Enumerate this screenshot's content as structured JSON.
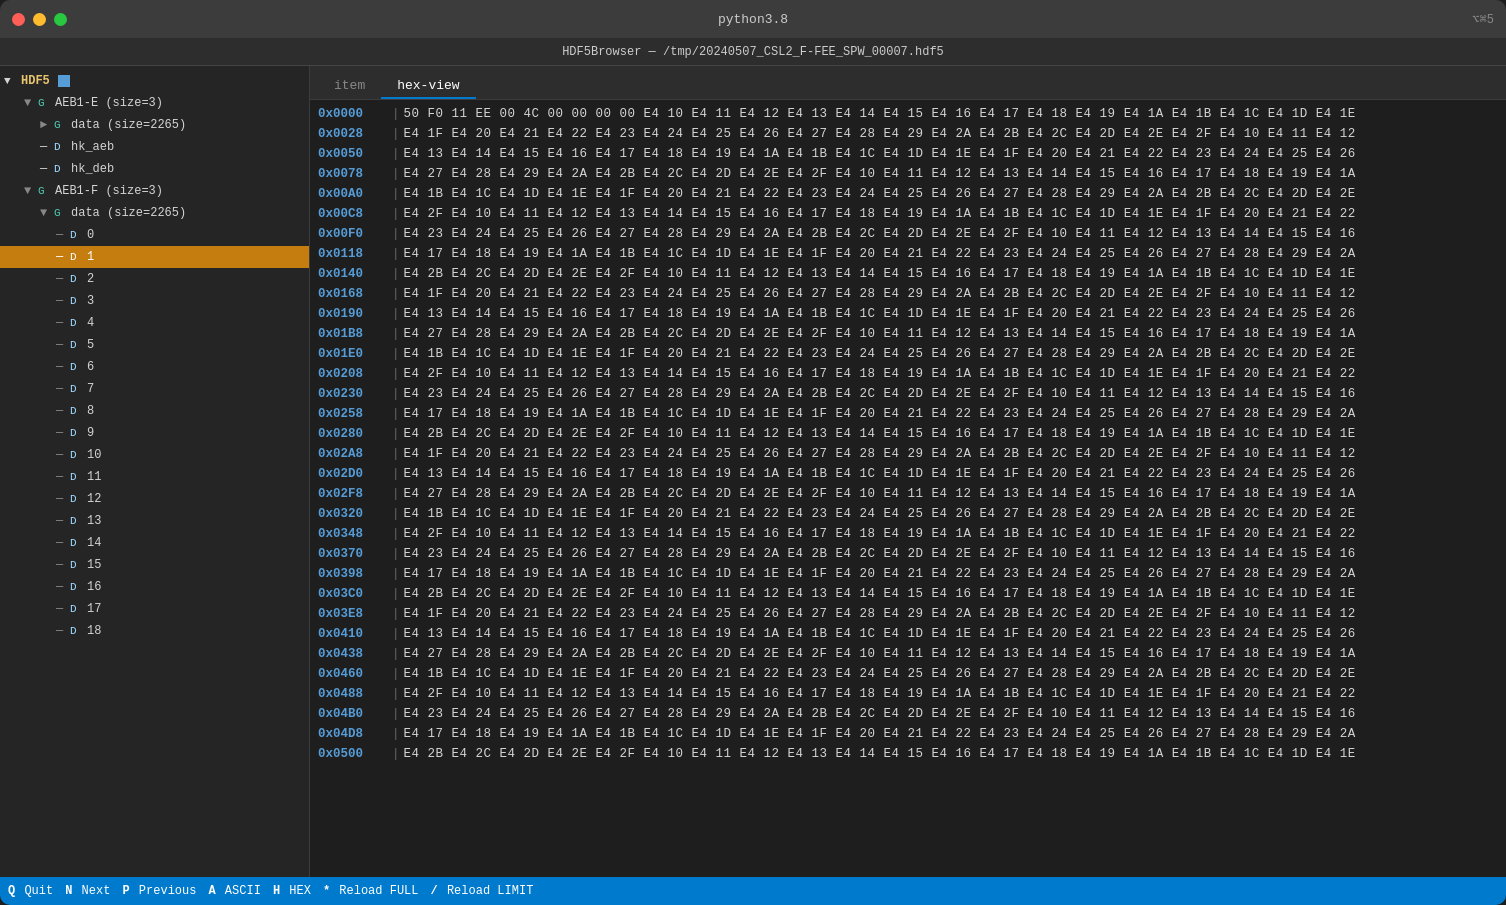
{
  "window": {
    "title": "python3.8",
    "subtitle": "HDF5Browser — /tmp/20240507_CSL2_F-FEE_SPW_00007.hdf5",
    "shortcut": "⌥⌘5"
  },
  "sidebar": {
    "root_label": "HDF5",
    "items": [
      {
        "id": "aeb1e",
        "indent": 1,
        "type": "G",
        "label": "AEB1-E (size=3)",
        "arrow": "▼",
        "expanded": true
      },
      {
        "id": "data_aeb1e",
        "indent": 2,
        "type": "G",
        "label": "data (size=2265)",
        "arrow": "►",
        "expanded": false
      },
      {
        "id": "hk_aeb",
        "indent": 2,
        "type": "D",
        "label": "hk_aeb",
        "arrow": "",
        "expanded": false
      },
      {
        "id": "hk_deb",
        "indent": 2,
        "type": "D",
        "label": "hk_deb",
        "arrow": "",
        "expanded": false
      },
      {
        "id": "aeb1f",
        "indent": 1,
        "type": "G",
        "label": "AEB1-F (size=3)",
        "arrow": "▼",
        "expanded": true
      },
      {
        "id": "data_aeb1f",
        "indent": 2,
        "type": "G",
        "label": "data (size=2265)",
        "arrow": "▼",
        "expanded": true
      },
      {
        "id": "d0",
        "indent": 3,
        "type": "D",
        "label": "0",
        "arrow": "",
        "expanded": false
      },
      {
        "id": "d1",
        "indent": 3,
        "type": "D",
        "label": "1",
        "arrow": "",
        "expanded": false,
        "selected": true
      },
      {
        "id": "d2",
        "indent": 3,
        "type": "D",
        "label": "2",
        "arrow": "",
        "expanded": false
      },
      {
        "id": "d3",
        "indent": 3,
        "type": "D",
        "label": "3",
        "arrow": "",
        "expanded": false
      },
      {
        "id": "d4",
        "indent": 3,
        "type": "D",
        "label": "4",
        "arrow": "",
        "expanded": false
      },
      {
        "id": "d5",
        "indent": 3,
        "type": "D",
        "label": "5",
        "arrow": "",
        "expanded": false
      },
      {
        "id": "d6",
        "indent": 3,
        "type": "D",
        "label": "6",
        "arrow": "",
        "expanded": false
      },
      {
        "id": "d7",
        "indent": 3,
        "type": "D",
        "label": "7",
        "arrow": "",
        "expanded": false
      },
      {
        "id": "d8",
        "indent": 3,
        "type": "D",
        "label": "8",
        "arrow": "",
        "expanded": false
      },
      {
        "id": "d9",
        "indent": 3,
        "type": "D",
        "label": "9",
        "arrow": "",
        "expanded": false
      },
      {
        "id": "d10",
        "indent": 3,
        "type": "D",
        "label": "10",
        "arrow": "",
        "expanded": false
      },
      {
        "id": "d11",
        "indent": 3,
        "type": "D",
        "label": "11",
        "arrow": "",
        "expanded": false
      },
      {
        "id": "d12",
        "indent": 3,
        "type": "D",
        "label": "12",
        "arrow": "",
        "expanded": false
      },
      {
        "id": "d13",
        "indent": 3,
        "type": "D",
        "label": "13",
        "arrow": "",
        "expanded": false
      },
      {
        "id": "d14",
        "indent": 3,
        "type": "D",
        "label": "14",
        "arrow": "",
        "expanded": false
      },
      {
        "id": "d15",
        "indent": 3,
        "type": "D",
        "label": "15",
        "arrow": "",
        "expanded": false
      },
      {
        "id": "d16",
        "indent": 3,
        "type": "D",
        "label": "16",
        "arrow": "",
        "expanded": false
      },
      {
        "id": "d17",
        "indent": 3,
        "type": "D",
        "label": "17",
        "arrow": "",
        "expanded": false
      },
      {
        "id": "d18",
        "indent": 3,
        "type": "D",
        "label": "18",
        "arrow": "",
        "expanded": false
      }
    ]
  },
  "tabs": [
    {
      "id": "item",
      "label": "item"
    },
    {
      "id": "hex-view",
      "label": "hex-view",
      "active": true
    }
  ],
  "hex_rows": [
    {
      "addr": "0x0000",
      "bytes": "50 F0 11 EE 00 4C 00 00 00 00 E4 10 E4 11 E4 12 E4 13 E4 14 E4 15 E4 16 E4 17 E4 18 E4 19 E4 1A E4 1B E4 1C E4 1D E4 1E"
    },
    {
      "addr": "0x0028",
      "bytes": "E4 1F E4 20 E4 21 E4 22 E4 23 E4 24 E4 25 E4 26 E4 27 E4 28 E4 29 E4 2A E4 2B E4 2C E4 2D E4 2E E4 2F E4 10 E4 11 E4 12"
    },
    {
      "addr": "0x0050",
      "bytes": "E4 13 E4 14 E4 15 E4 16 E4 17 E4 18 E4 19 E4 1A E4 1B E4 1C E4 1D E4 1E E4 1F E4 20 E4 21 E4 22 E4 23 E4 24 E4 25 E4 26"
    },
    {
      "addr": "0x0078",
      "bytes": "E4 27 E4 28 E4 29 E4 2A E4 2B E4 2C E4 2D E4 2E E4 2F E4 10 E4 11 E4 12 E4 13 E4 14 E4 15 E4 16 E4 17 E4 18 E4 19 E4 1A"
    },
    {
      "addr": "0x00A0",
      "bytes": "E4 1B E4 1C E4 1D E4 1E E4 1F E4 20 E4 21 E4 22 E4 23 E4 24 E4 25 E4 26 E4 27 E4 28 E4 29 E4 2A E4 2B E4 2C E4 2D E4 2E"
    },
    {
      "addr": "0x00C8",
      "bytes": "E4 2F E4 10 E4 11 E4 12 E4 13 E4 14 E4 15 E4 16 E4 17 E4 18 E4 19 E4 1A E4 1B E4 1C E4 1D E4 1E E4 1F E4 20 E4 21 E4 22"
    },
    {
      "addr": "0x00F0",
      "bytes": "E4 23 E4 24 E4 25 E4 26 E4 27 E4 28 E4 29 E4 2A E4 2B E4 2C E4 2D E4 2E E4 2F E4 10 E4 11 E4 12 E4 13 E4 14 E4 15 E4 16"
    },
    {
      "addr": "0x0118",
      "bytes": "E4 17 E4 18 E4 19 E4 1A E4 1B E4 1C E4 1D E4 1E E4 1F E4 20 E4 21 E4 22 E4 23 E4 24 E4 25 E4 26 E4 27 E4 28 E4 29 E4 2A"
    },
    {
      "addr": "0x0140",
      "bytes": "E4 2B E4 2C E4 2D E4 2E E4 2F E4 10 E4 11 E4 12 E4 13 E4 14 E4 15 E4 16 E4 17 E4 18 E4 19 E4 1A E4 1B E4 1C E4 1D E4 1E"
    },
    {
      "addr": "0x0168",
      "bytes": "E4 1F E4 20 E4 21 E4 22 E4 23 E4 24 E4 25 E4 26 E4 27 E4 28 E4 29 E4 2A E4 2B E4 2C E4 2D E4 2E E4 2F E4 10 E4 11 E4 12"
    },
    {
      "addr": "0x0190",
      "bytes": "E4 13 E4 14 E4 15 E4 16 E4 17 E4 18 E4 19 E4 1A E4 1B E4 1C E4 1D E4 1E E4 1F E4 20 E4 21 E4 22 E4 23 E4 24 E4 25 E4 26"
    },
    {
      "addr": "0x01B8",
      "bytes": "E4 27 E4 28 E4 29 E4 2A E4 2B E4 2C E4 2D E4 2E E4 2F E4 10 E4 11 E4 12 E4 13 E4 14 E4 15 E4 16 E4 17 E4 18 E4 19 E4 1A"
    },
    {
      "addr": "0x01E0",
      "bytes": "E4 1B E4 1C E4 1D E4 1E E4 1F E4 20 E4 21 E4 22 E4 23 E4 24 E4 25 E4 26 E4 27 E4 28 E4 29 E4 2A E4 2B E4 2C E4 2D E4 2E"
    },
    {
      "addr": "0x0208",
      "bytes": "E4 2F E4 10 E4 11 E4 12 E4 13 E4 14 E4 15 E4 16 E4 17 E4 18 E4 19 E4 1A E4 1B E4 1C E4 1D E4 1E E4 1F E4 20 E4 21 E4 22"
    },
    {
      "addr": "0x0230",
      "bytes": "E4 23 E4 24 E4 25 E4 26 E4 27 E4 28 E4 29 E4 2A E4 2B E4 2C E4 2D E4 2E E4 2F E4 10 E4 11 E4 12 E4 13 E4 14 E4 15 E4 16"
    },
    {
      "addr": "0x0258",
      "bytes": "E4 17 E4 18 E4 19 E4 1A E4 1B E4 1C E4 1D E4 1E E4 1F E4 20 E4 21 E4 22 E4 23 E4 24 E4 25 E4 26 E4 27 E4 28 E4 29 E4 2A"
    },
    {
      "addr": "0x0280",
      "bytes": "E4 2B E4 2C E4 2D E4 2E E4 2F E4 10 E4 11 E4 12 E4 13 E4 14 E4 15 E4 16 E4 17 E4 18 E4 19 E4 1A E4 1B E4 1C E4 1D E4 1E"
    },
    {
      "addr": "0x02A8",
      "bytes": "E4 1F E4 20 E4 21 E4 22 E4 23 E4 24 E4 25 E4 26 E4 27 E4 28 E4 29 E4 2A E4 2B E4 2C E4 2D E4 2E E4 2F E4 10 E4 11 E4 12"
    },
    {
      "addr": "0x02D0",
      "bytes": "E4 13 E4 14 E4 15 E4 16 E4 17 E4 18 E4 19 E4 1A E4 1B E4 1C E4 1D E4 1E E4 1F E4 20 E4 21 E4 22 E4 23 E4 24 E4 25 E4 26"
    },
    {
      "addr": "0x02F8",
      "bytes": "E4 27 E4 28 E4 29 E4 2A E4 2B E4 2C E4 2D E4 2E E4 2F E4 10 E4 11 E4 12 E4 13 E4 14 E4 15 E4 16 E4 17 E4 18 E4 19 E4 1A"
    },
    {
      "addr": "0x0320",
      "bytes": "E4 1B E4 1C E4 1D E4 1E E4 1F E4 20 E4 21 E4 22 E4 23 E4 24 E4 25 E4 26 E4 27 E4 28 E4 29 E4 2A E4 2B E4 2C E4 2D E4 2E"
    },
    {
      "addr": "0x0348",
      "bytes": "E4 2F E4 10 E4 11 E4 12 E4 13 E4 14 E4 15 E4 16 E4 17 E4 18 E4 19 E4 1A E4 1B E4 1C E4 1D E4 1E E4 1F E4 20 E4 21 E4 22"
    },
    {
      "addr": "0x0370",
      "bytes": "E4 23 E4 24 E4 25 E4 26 E4 27 E4 28 E4 29 E4 2A E4 2B E4 2C E4 2D E4 2E E4 2F E4 10 E4 11 E4 12 E4 13 E4 14 E4 15 E4 16"
    },
    {
      "addr": "0x0398",
      "bytes": "E4 17 E4 18 E4 19 E4 1A E4 1B E4 1C E4 1D E4 1E E4 1F E4 20 E4 21 E4 22 E4 23 E4 24 E4 25 E4 26 E4 27 E4 28 E4 29 E4 2A"
    },
    {
      "addr": "0x03C0",
      "bytes": "E4 2B E4 2C E4 2D E4 2E E4 2F E4 10 E4 11 E4 12 E4 13 E4 14 E4 15 E4 16 E4 17 E4 18 E4 19 E4 1A E4 1B E4 1C E4 1D E4 1E"
    },
    {
      "addr": "0x03E8",
      "bytes": "E4 1F E4 20 E4 21 E4 22 E4 23 E4 24 E4 25 E4 26 E4 27 E4 28 E4 29 E4 2A E4 2B E4 2C E4 2D E4 2E E4 2F E4 10 E4 11 E4 12"
    },
    {
      "addr": "0x0410",
      "bytes": "E4 13 E4 14 E4 15 E4 16 E4 17 E4 18 E4 19 E4 1A E4 1B E4 1C E4 1D E4 1E E4 1F E4 20 E4 21 E4 22 E4 23 E4 24 E4 25 E4 26"
    },
    {
      "addr": "0x0438",
      "bytes": "E4 27 E4 28 E4 29 E4 2A E4 2B E4 2C E4 2D E4 2E E4 2F E4 10 E4 11 E4 12 E4 13 E4 14 E4 15 E4 16 E4 17 E4 18 E4 19 E4 1A"
    },
    {
      "addr": "0x0460",
      "bytes": "E4 1B E4 1C E4 1D E4 1E E4 1F E4 20 E4 21 E4 22 E4 23 E4 24 E4 25 E4 26 E4 27 E4 28 E4 29 E4 2A E4 2B E4 2C E4 2D E4 2E"
    },
    {
      "addr": "0x0488",
      "bytes": "E4 2F E4 10 E4 11 E4 12 E4 13 E4 14 E4 15 E4 16 E4 17 E4 18 E4 19 E4 1A E4 1B E4 1C E4 1D E4 1E E4 1F E4 20 E4 21 E4 22"
    },
    {
      "addr": "0x04B0",
      "bytes": "E4 23 E4 24 E4 25 E4 26 E4 27 E4 28 E4 29 E4 2A E4 2B E4 2C E4 2D E4 2E E4 2F E4 10 E4 11 E4 12 E4 13 E4 14 E4 15 E4 16"
    },
    {
      "addr": "0x04D8",
      "bytes": "E4 17 E4 18 E4 19 E4 1A E4 1B E4 1C E4 1D E4 1E E4 1F E4 20 E4 21 E4 22 E4 23 E4 24 E4 25 E4 26 E4 27 E4 28 E4 29 E4 2A"
    },
    {
      "addr": "0x0500",
      "bytes": "E4 2B E4 2C E4 2D E4 2E E4 2F E4 10 E4 11 E4 12 E4 13 E4 14 E4 15 E4 16 E4 17 E4 18 E4 19 E4 1A E4 1B E4 1C E4 1D E4 1E"
    }
  ],
  "status_bar": {
    "items": [
      {
        "key": "Q",
        "label": "Quit"
      },
      {
        "key": "N",
        "label": "Next"
      },
      {
        "key": "P",
        "label": "Previous"
      },
      {
        "key": "A",
        "label": "ASCII"
      },
      {
        "key": "H",
        "label": "HEX"
      },
      {
        "key": "*",
        "label": "Reload FULL"
      },
      {
        "key": "/",
        "label": "Reload LIMIT"
      }
    ]
  }
}
